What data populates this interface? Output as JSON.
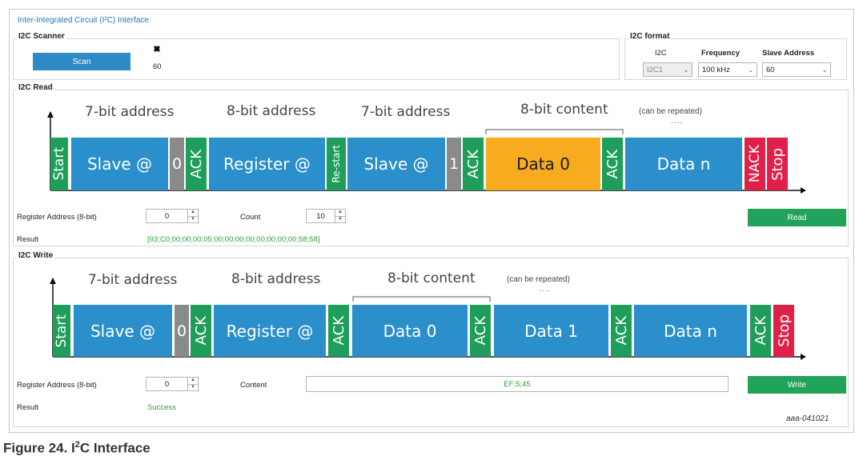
{
  "app_title": "Inter-Integrated Circuit (I²C) Interface",
  "scanner": {
    "group_label": "I2C Scanner",
    "scan_button": "Scan",
    "indicator_icon": "chip-icon",
    "found_address": "60"
  },
  "format": {
    "group_label": "I2C format",
    "i2c_label": "I2C",
    "i2c_value": "I2C1",
    "frequency_label": "Frequency",
    "frequency_value": "100 kHz",
    "slave_label": "Slave Address",
    "slave_value": "60"
  },
  "read": {
    "group_label": "I2C Read",
    "diagram": {
      "headers": [
        "7-bit address",
        "8-bit address",
        "7-bit address",
        "8-bit content"
      ],
      "repeat_note": "(can be repeated)",
      "repeat_dots": "....",
      "segments": {
        "start": "Start",
        "slave1": "Slave @",
        "zero": "0",
        "ack1": "ACK",
        "register": "Register @",
        "restart": "Re-start",
        "slave2": "Slave @",
        "one": "1",
        "ack2": "ACK",
        "data0": "Data 0",
        "ack3": "ACK",
        "datan": "Data n",
        "nack": "NACK",
        "stop": "Stop"
      }
    },
    "register_label": "Register Address (8-bit)",
    "register_value": "0",
    "count_label": "Count",
    "count_value": "10",
    "read_button": "Read",
    "result_label": "Result",
    "result_value": "[93;C0;00;00;00;05;00;00;00;00;00;00;00;00;58;58]"
  },
  "write": {
    "group_label": "I2C Write",
    "diagram": {
      "headers": [
        "7-bit address",
        "8-bit address",
        "8-bit content"
      ],
      "repeat_note": "(can be repeated)",
      "repeat_dots": "....",
      "segments": {
        "start": "Start",
        "slave": "Slave @",
        "zero": "0",
        "ack1": "ACK",
        "register": "Register @",
        "ack2": "ACK",
        "data0": "Data 0",
        "ack3": "ACK",
        "data1": "Data 1",
        "ack4": "ACK",
        "datan": "Data n",
        "ack5": "ACK",
        "stop": "Stop"
      }
    },
    "register_label": "Register Address (8-bit)",
    "register_value": "0",
    "content_label": "Content",
    "content_value": "EF;5;45",
    "write_button": "Write",
    "result_label": "Result",
    "result_value": "Success"
  },
  "figure_id": "aaa-041021",
  "caption": {
    "prefix": "Figure 24.  I",
    "sup": "2",
    "suffix": "C Interface"
  },
  "colors": {
    "blue": "#2a8fcb",
    "green": "#1e9e5a",
    "gray": "#8a8a8a",
    "orange": "#f7ab1e",
    "red": "#e02049"
  }
}
